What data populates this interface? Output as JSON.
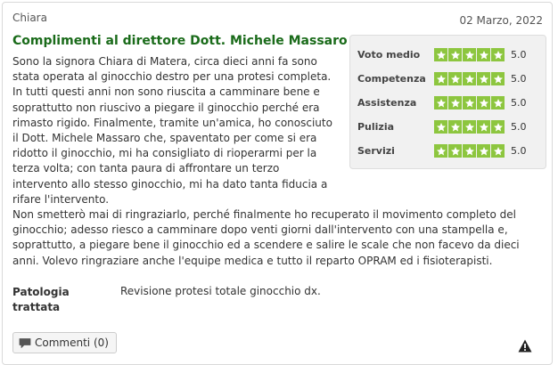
{
  "review": {
    "author": "Chiara",
    "date": "02 Marzo, 2022",
    "title": "Complimenti al direttore Dott. Michele Massaro",
    "body_narrow": "Sono la signora Chiara di Matera, circa dieci anni fa sono\nstata operata al ginocchio destro per una protesi completa.\nIn tutti questi anni non sono riuscita a camminare bene e\nsoprattutto non riuscivo a piegare il ginocchio perché era\nrimasto rigido. Finalmente, tramite un'amica, ho conosciuto\nil Dott. Michele Massaro che, spaventato per come si era\nridotto il ginocchio, mi ha consigliato di rioperarmi per la\nterza volta; con tanta paura di affrontare un terzo\nintervento allo stesso ginocchio, mi ha dato tanta fiducia a\nrifare l'intervento.",
    "body_wide": "Non smetterò mai di ringraziarlo, perché finalmente ho recuperato il movimento completo del\nginocchio; adesso riesco a camminare dopo venti giorni dall'intervento con una stampella e,\nsoprattutto, a piegare bene il ginocchio ed a scendere e salire le scale che non facevo da dieci\nanni. Volevo ringraziare anche l'equipe medica e tutto il reparto OPRAM ed i fisioterapisti.",
    "patologia_label": "Patologia trattata",
    "patologia_value": "Revisione protesi totale ginocchio dx."
  },
  "ratings": [
    {
      "label": "Voto medio",
      "stars": 5,
      "value": "5.0"
    },
    {
      "label": "Competenza",
      "stars": 5,
      "value": "5.0"
    },
    {
      "label": "Assistenza",
      "stars": 5,
      "value": "5.0"
    },
    {
      "label": "Pulizia",
      "stars": 5,
      "value": "5.0"
    },
    {
      "label": "Servizi",
      "stars": 5,
      "value": "5.0"
    }
  ],
  "actions": {
    "comments_label": "Commenti (0)",
    "comments_icon": "comment-icon",
    "report_icon": "warning-icon"
  },
  "colors": {
    "title": "#1a6b1a",
    "star_bg": "#8dc63f"
  }
}
